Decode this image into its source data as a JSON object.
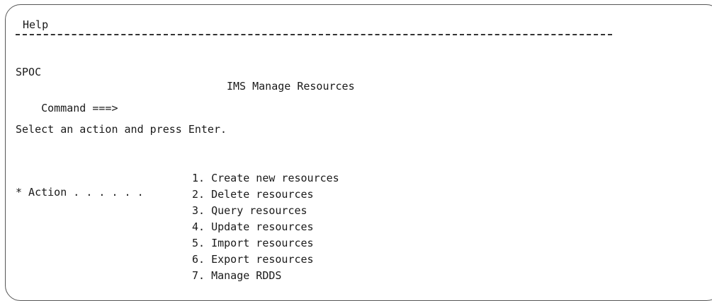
{
  "menu_bar": {
    "help_label": "Help"
  },
  "header": {
    "rule": "-----------------------------------------------------------------------------",
    "app_id": "SPOC",
    "title": "IMS Manage Resources"
  },
  "command": {
    "prompt": "Command ===>",
    "value": ""
  },
  "instruction": "Select an action and press Enter.",
  "action": {
    "label": "* Action . . . . . .",
    "options": [
      {
        "num": "1.",
        "label": "Create new resources"
      },
      {
        "num": "2.",
        "label": "Delete resources"
      },
      {
        "num": "3.",
        "label": "Query resources"
      },
      {
        "num": "4.",
        "label": "Update resources"
      },
      {
        "num": "5.",
        "label": "Import resources"
      },
      {
        "num": "6.",
        "label": "Export resources"
      },
      {
        "num": "7.",
        "label": "Manage RDDS"
      }
    ]
  }
}
